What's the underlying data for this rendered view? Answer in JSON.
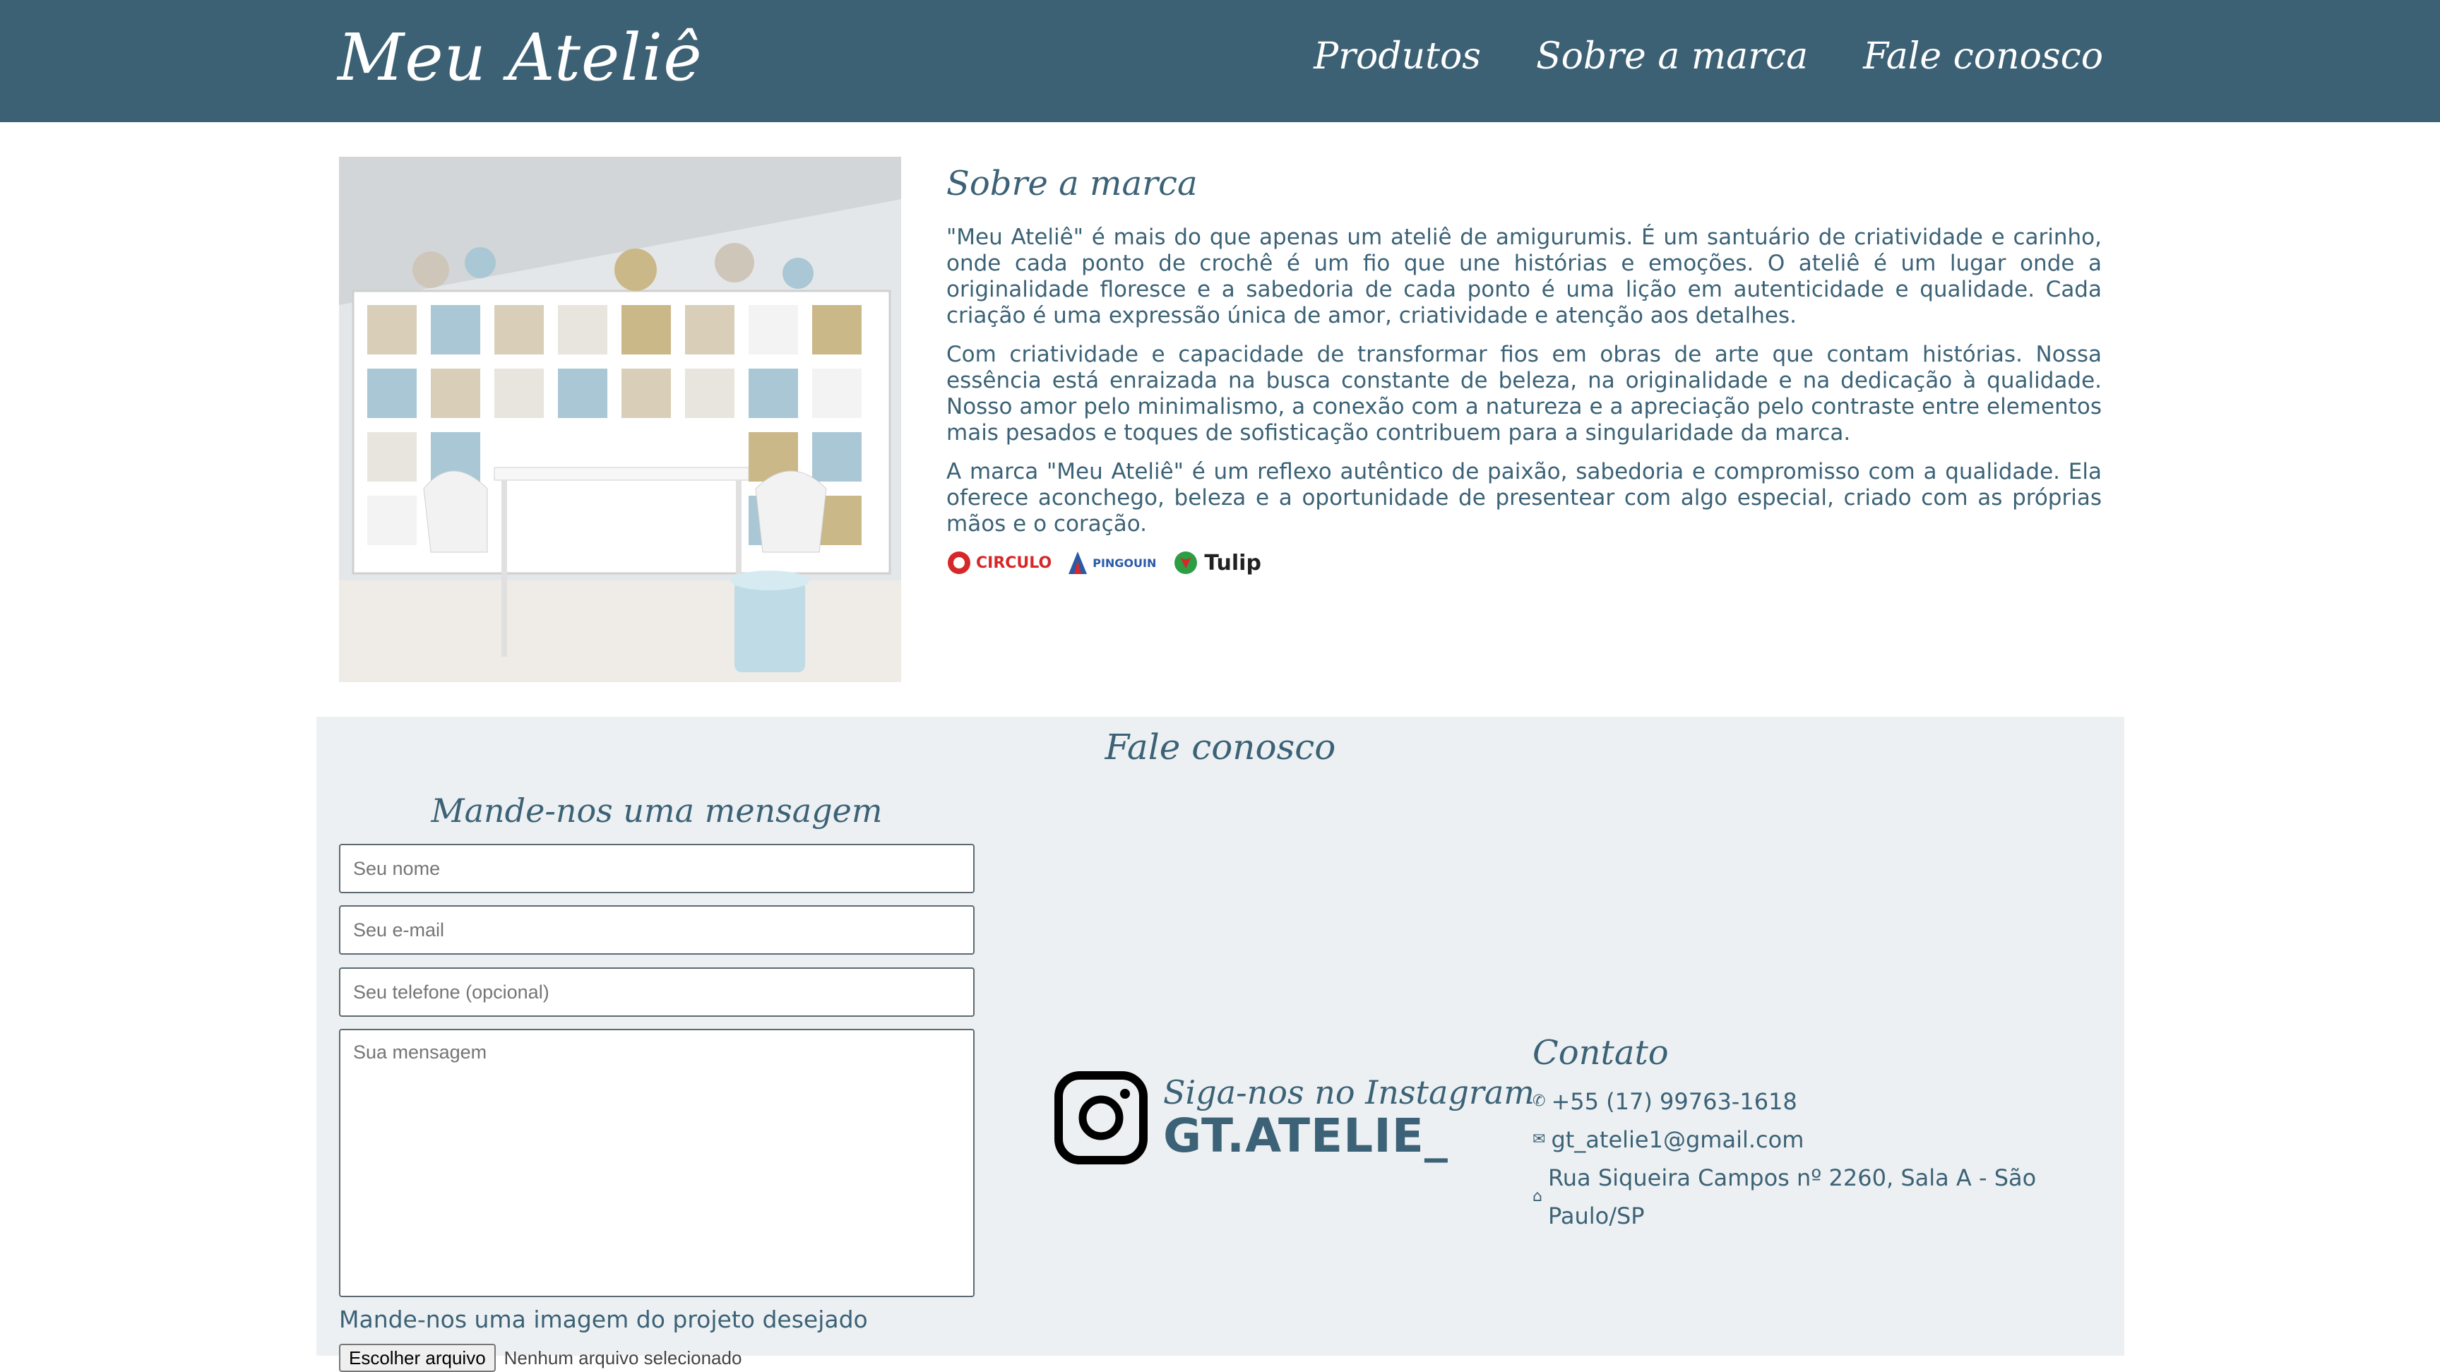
{
  "header": {
    "brand": "Meu Ateliê",
    "nav": [
      "Produtos",
      "Sobre a marca",
      "Fale conosco"
    ]
  },
  "about": {
    "title": "Sobre a marca",
    "paragraphs": [
      "\"Meu Ateliê\" é mais do que apenas um ateliê de amigurumis. É um santuário de criatividade e carinho, onde cada ponto de crochê é um fio que une histórias e emoções. O ateliê é um lugar onde a originalidade floresce e a sabedoria de cada ponto é uma lição em autenticidade e qualidade. Cada criação é uma expressão única de amor, criatividade e atenção aos detalhes.",
      "Com criatividade e capacidade de transformar fios em obras de arte que contam histórias. Nossa essência está enraizada na busca constante de beleza, na originalidade e na dedicação à qualidade. Nosso amor pelo minimalismo, a conexão com a natureza e a apreciação pelo contraste entre elementos mais pesados e toques de sofisticação contribuem para a singularidade da marca.",
      "A marca \"Meu Ateliê\" é um reflexo autêntico de paixão, sabedoria e compromisso com a qualidade. Ela oferece aconchego, beleza e a oportunidade de presentear com algo especial, criado com as próprias mãos e o coração."
    ],
    "brands": [
      "CIRCULO",
      "PINGOUIN",
      "Tulip"
    ]
  },
  "contact": {
    "title": "Fale conosco",
    "form_title": "Mande-nos uma mensagem",
    "name_placeholder": "Seu nome",
    "email_placeholder": "Seu e-mail",
    "phone_placeholder": "Seu telefone (opcional)",
    "message_placeholder": "Sua mensagem",
    "upload_label": "Mande-nos uma imagem do projeto desejado",
    "file_button": "Escolher arquivo",
    "file_status": "Nenhum arquivo selecionado",
    "instagram": {
      "follow": "Siga-nos no Instagram",
      "handle": "GT.ATELIE_"
    },
    "info": {
      "title": "Contato",
      "phone": "+55 (17) 99763-1618",
      "email": "gt_atelie1@gmail.com",
      "address": "Rua Siqueira Campos nº 2260, Sala A - São Paulo/SP"
    }
  },
  "icons": {
    "phone": "phone-icon",
    "email": "envelope-icon",
    "address": "home-icon",
    "instagram": "instagram-icon"
  },
  "colors": {
    "primary": "#3c6174",
    "section_bg": "#edf0f2",
    "text": "#3b6276"
  }
}
